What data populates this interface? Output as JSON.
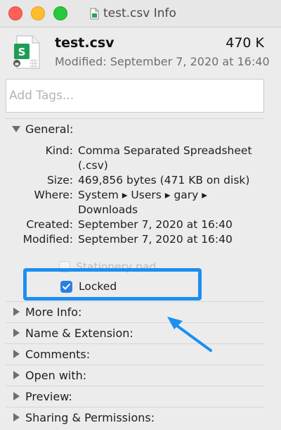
{
  "window": {
    "title": "test.csv Info"
  },
  "header": {
    "file_name": "test.csv",
    "file_size": "470 K",
    "modified_line": "Modified: September 7, 2020 at 16:40",
    "file_icon": "spreadsheet-file-icon"
  },
  "tags": {
    "placeholder": "Add Tags..."
  },
  "general": {
    "label": "General:",
    "rows": [
      {
        "key": "Kind:",
        "value": "Comma Separated Spreadsheet"
      },
      {
        "key": "",
        "value": "(.csv)"
      },
      {
        "key": "Size:",
        "value": "469,856 bytes (471 KB on disk)"
      },
      {
        "key": "Where:",
        "value": "System ▸ Users ▸ gary ▸"
      },
      {
        "key": "",
        "value": "Downloads"
      },
      {
        "key": "Created:",
        "value": "September 7, 2020 at 16:40"
      },
      {
        "key": "Modified:",
        "value": "September 7, 2020 at 16:40"
      }
    ],
    "stationery_label": "Stationery pad",
    "locked_label": "Locked",
    "locked_checked": true
  },
  "sections": [
    {
      "label": "More Info:"
    },
    {
      "label": "Name & Extension:"
    },
    {
      "label": "Comments:"
    },
    {
      "label": "Open with:"
    },
    {
      "label": "Preview:"
    },
    {
      "label": "Sharing & Permissions:"
    }
  ],
  "colors": {
    "highlight": "#1c8ff0",
    "checkbox": "#2a7fe6",
    "spreadsheet_green": "#1f9d55"
  }
}
